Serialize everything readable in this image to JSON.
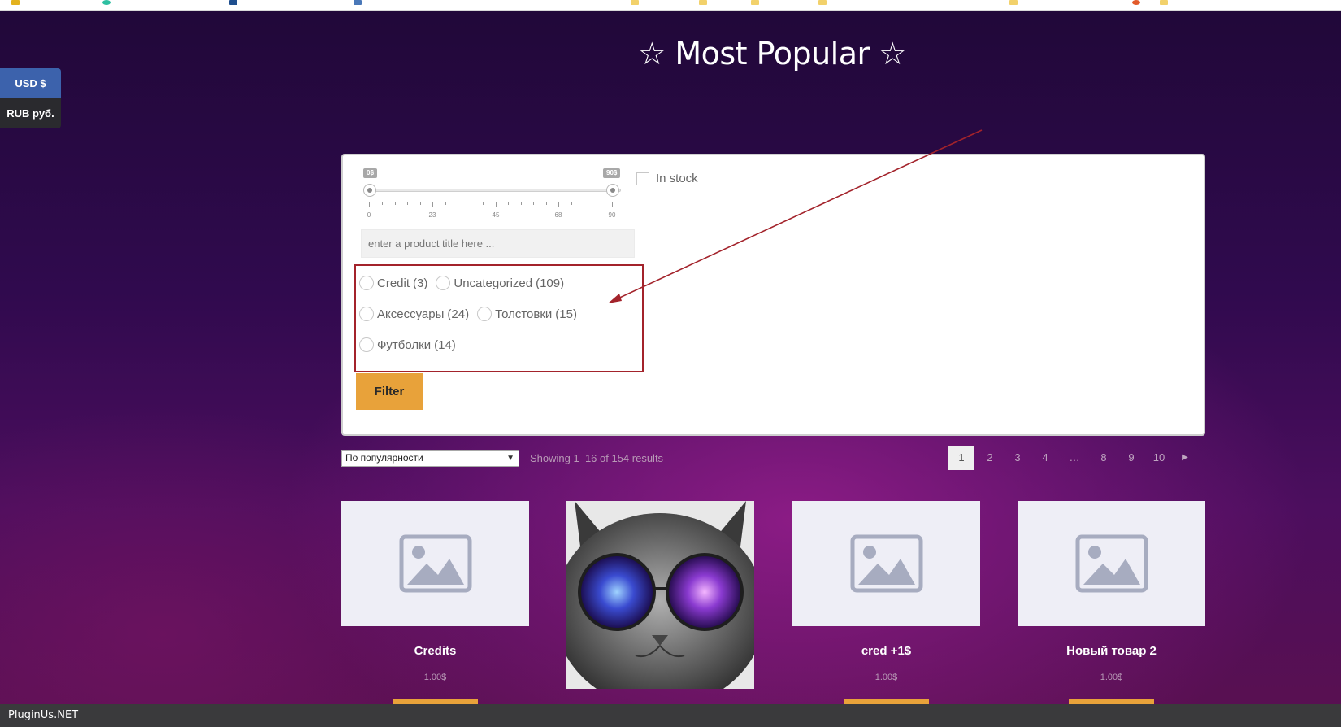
{
  "page_title": "☆ Most Popular ☆",
  "currency": {
    "usd": "USD $",
    "rub": "RUB руб."
  },
  "filter": {
    "price_min_label": "0$",
    "price_max_label": "90$",
    "price_ticks": [
      "0",
      "23",
      "45",
      "68",
      "90"
    ],
    "in_stock_label": "In stock",
    "search_placeholder": "enter a product title here ...",
    "categories": [
      {
        "label": "Credit",
        "count": "(3)"
      },
      {
        "label": "Uncategorized",
        "count": "(109)"
      },
      {
        "label": "Аксессуары",
        "count": "(24)"
      },
      {
        "label": "Толстовки",
        "count": "(15)"
      },
      {
        "label": "Футболки",
        "count": "(14)"
      }
    ],
    "filter_button": "Filter"
  },
  "toolbar": {
    "sort_value": "По популярности",
    "result_count": "Showing 1–16 of 154 results",
    "pages": [
      "1",
      "2",
      "3",
      "4",
      "…",
      "8",
      "9",
      "10"
    ]
  },
  "products": [
    {
      "title": "Credits",
      "price": "1.00$"
    },
    {
      "title": "",
      "price": ""
    },
    {
      "title": "cred +1$",
      "price": "1.00$"
    },
    {
      "title": "Новый товар 2",
      "price": "1.00$"
    }
  ],
  "footer_text": "PluginUs.NET",
  "colors": {
    "accent": "#e8a23a",
    "usd_button": "#3c62ac",
    "annotation_red": "#a3232b"
  }
}
